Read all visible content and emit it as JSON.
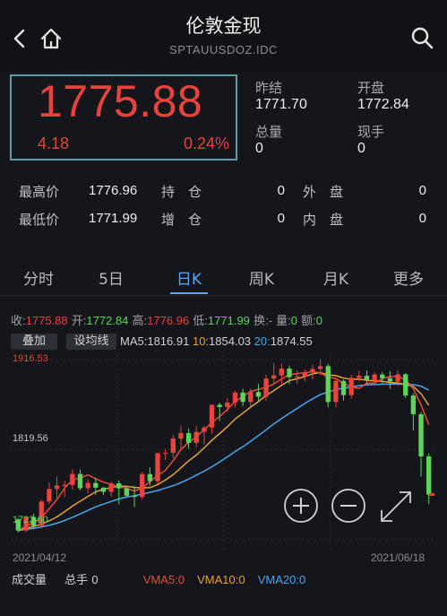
{
  "header": {
    "title": "伦敦金现",
    "subtitle": "SPTAUUSDOZ.IDC"
  },
  "quote": {
    "price": "1775.88",
    "change": "4.18",
    "change_pct": "0.24%",
    "prev_close_label": "昨结",
    "prev_close": "1771.70",
    "open_label": "开盘",
    "open": "1772.84",
    "volume_label": "总量",
    "volume": "0",
    "current_hand_label": "现手",
    "current_hand": "0"
  },
  "stats_rows": [
    {
      "l1": "最高价",
      "v1": "1776.96",
      "l2": "持　仓",
      "v2": "0",
      "l3": "外　盘",
      "v3": "0"
    },
    {
      "l1": "最低价",
      "v1": "1771.99",
      "l2": "增　仓",
      "v2": "0",
      "l3": "内　盘",
      "v3": "0"
    }
  ],
  "tabs": [
    "分时",
    "5日",
    "日K",
    "周K",
    "月K",
    "更多"
  ],
  "active_tab": "日K",
  "ohlc": {
    "close_label": "收:",
    "close": "1775.88",
    "open_label": "开:",
    "open": "1772.84",
    "high_label": "高:",
    "high": "1776.96",
    "low_label": "低:",
    "low": "1771.99",
    "turnover_label": "换:",
    "turnover": "-",
    "qty_label": "量:",
    "qty": "0",
    "amount_label": "额:",
    "amount": "0"
  },
  "overlay": {
    "stack_button": "叠加",
    "indicator_button": "设均线",
    "ma5_label": "MA5:",
    "ma5": "1816.91",
    "ma10_label": "10:",
    "ma10": "1854.03",
    "ma20_label": "20:",
    "ma20": "1874.55"
  },
  "axis": {
    "top": "1916.53",
    "mid": "1819.56",
    "bottom": "1722.60",
    "date_start": "2021/04/12",
    "date_end": "2021/06/18"
  },
  "volume_row": {
    "label": "成交量",
    "hand_label": "总手",
    "hand": "0",
    "vma5_label": "VMA5:",
    "vma5": "0",
    "vma10_label": "VMA10:",
    "vma10": "0",
    "vma20_label": "VMA20:",
    "vma20": "0"
  },
  "colors": {
    "up": "#e8433d",
    "down": "#5fd35a",
    "ma5": "#ea4a3c",
    "ma10": "#e6a23a",
    "ma20": "#4aa6ec",
    "accent": "#5aa8f0"
  },
  "chart_data": {
    "type": "candlestick",
    "y_range": [
      1722.6,
      1916.53
    ],
    "x_range": [
      "2021/04/12",
      "2021/06/18"
    ],
    "ohlc": [
      [
        1743.7,
        1745.1,
        1729.5,
        1731.6
      ],
      [
        1731.6,
        1747.3,
        1730.0,
        1746.2
      ],
      [
        1746.2,
        1749.8,
        1733.0,
        1736.5
      ],
      [
        1736.5,
        1765.2,
        1734.0,
        1763.0
      ],
      [
        1763.0,
        1783.4,
        1760.0,
        1776.6
      ],
      [
        1776.6,
        1790.1,
        1767.0,
        1780.4
      ],
      [
        1780.4,
        1785.5,
        1767.9,
        1781.0
      ],
      [
        1781.0,
        1798.0,
        1776.0,
        1792.8
      ],
      [
        1792.8,
        1797.6,
        1775.0,
        1777.4
      ],
      [
        1777.4,
        1787.1,
        1772.0,
        1783.1
      ],
      [
        1783.1,
        1789.0,
        1770.0,
        1778.0
      ],
      [
        1778.0,
        1779.0,
        1770.0,
        1773.5
      ],
      [
        1773.5,
        1784.5,
        1768.5,
        1782.7
      ],
      [
        1782.7,
        1786.0,
        1760.0,
        1777.2
      ],
      [
        1777.2,
        1780.0,
        1768.0,
        1769.3
      ],
      [
        1769.3,
        1780.0,
        1757.0,
        1767.9
      ],
      [
        1767.9,
        1795.0,
        1765.0,
        1792.7
      ],
      [
        1792.7,
        1800.0,
        1780.0,
        1785.0
      ],
      [
        1785.0,
        1816.0,
        1780.0,
        1815.3
      ],
      [
        1815.3,
        1820.0,
        1808.0,
        1815.8
      ],
      [
        1815.8,
        1835.0,
        1810.0,
        1831.1
      ],
      [
        1831.1,
        1845.0,
        1818.0,
        1837.0
      ],
      [
        1837.0,
        1842.0,
        1820.0,
        1826.4
      ],
      [
        1826.4,
        1845.0,
        1822.0,
        1838.3
      ],
      [
        1838.3,
        1845.0,
        1825.0,
        1843.0
      ],
      [
        1843.0,
        1868.0,
        1836.0,
        1867.6
      ],
      [
        1867.6,
        1870.0,
        1850.0,
        1865.2
      ],
      [
        1865.2,
        1875.0,
        1860.0,
        1870.0
      ],
      [
        1870.0,
        1883.0,
        1865.0,
        1880.9
      ],
      [
        1880.9,
        1885.0,
        1866.0,
        1870.7
      ],
      [
        1870.7,
        1885.0,
        1866.0,
        1881.4
      ],
      [
        1881.4,
        1890.0,
        1872.0,
        1876.4
      ],
      [
        1876.4,
        1900.0,
        1872.0,
        1896.0
      ],
      [
        1896.0,
        1913.0,
        1889.0,
        1899.4
      ],
      [
        1899.4,
        1912.0,
        1890.0,
        1906.8
      ],
      [
        1906.8,
        1910.0,
        1890.0,
        1897.5
      ],
      [
        1897.5,
        1905.0,
        1890.0,
        1898.4
      ],
      [
        1898.4,
        1906.0,
        1893.0,
        1902.7
      ],
      [
        1902.7,
        1911.0,
        1895.0,
        1906.4
      ],
      [
        1906.4,
        1916.5,
        1900.0,
        1909.4
      ],
      [
        1909.4,
        1912.0,
        1865.0,
        1870.6
      ],
      [
        1870.6,
        1895.0,
        1865.0,
        1893.4
      ],
      [
        1893.4,
        1895.0,
        1872.0,
        1878.0
      ],
      [
        1878.0,
        1900.0,
        1874.0,
        1896.8
      ],
      [
        1896.8,
        1904.0,
        1893.0,
        1899.0
      ],
      [
        1899.0,
        1905.0,
        1890.0,
        1894.2
      ],
      [
        1894.2,
        1903.0,
        1892.0,
        1900.3
      ],
      [
        1900.3,
        1903.0,
        1890.0,
        1896.4
      ],
      [
        1896.4,
        1904.0,
        1885.0,
        1892.7
      ],
      [
        1892.7,
        1905.0,
        1888.0,
        1900.5
      ],
      [
        1900.5,
        1902.0,
        1875.0,
        1877.6
      ],
      [
        1877.6,
        1880.0,
        1840.0,
        1857.4
      ],
      [
        1857.4,
        1860.0,
        1790.0,
        1811.8
      ],
      [
        1811.8,
        1815.0,
        1760.0,
        1770.6
      ]
    ],
    "ma5": [
      1731.6,
      1736.5,
      1740.0,
      1745.6,
      1755.2,
      1765.3,
      1777.5,
      1786.4,
      1788.3,
      1791.8,
      1787.6,
      1784.0,
      1781.6,
      1779.2,
      1777.4,
      1774.3,
      1777.5,
      1784.5,
      1791.2,
      1796.8,
      1807.2,
      1819.3,
      1826.9,
      1832.8,
      1840.8,
      1848.4,
      1854.9,
      1862.6,
      1871.3,
      1876.5,
      1882.0,
      1884.3,
      1886.5,
      1890.2,
      1895.6,
      1900.3,
      1901.4,
      1902.4,
      1903.4,
      1902.2,
      1897.4,
      1896.1,
      1890.7,
      1886.9,
      1885.4,
      1891.1,
      1890.9,
      1895.9,
      1898.1,
      1898.3,
      1894.8,
      1884.9,
      1867.6,
      1846.1
    ],
    "ma10": [
      1731.6,
      1734.0,
      1736.0,
      1738.5,
      1742.0,
      1746.5,
      1752.1,
      1758.1,
      1763.3,
      1768.6,
      1773.5,
      1776.3,
      1778.1,
      1779.7,
      1779.4,
      1778.3,
      1777.9,
      1778.0,
      1781.3,
      1786.2,
      1792.0,
      1799.4,
      1807.0,
      1813.3,
      1821.0,
      1829.2,
      1836.5,
      1843.9,
      1852.1,
      1858.6,
      1865.1,
      1871.1,
      1877.7,
      1883.0,
      1888.8,
      1893.8,
      1895.8,
      1898.1,
      1901.2,
      1902.5,
      1899.9,
      1899.2,
      1896.5,
      1895.2,
      1895.5,
      1894.1,
      1893.4,
      1893.1,
      1891.7,
      1891.3,
      1889.6,
      1887.4,
      1879.6,
      1867.1
    ],
    "ma20": [
      1731.6,
      1733.0,
      1734.0,
      1735.5,
      1737.2,
      1739.6,
      1742.6,
      1746.0,
      1749.6,
      1753.4,
      1757.2,
      1760.2,
      1763.0,
      1765.8,
      1767.8,
      1769.3,
      1771.0,
      1772.9,
      1775.0,
      1777.6,
      1780.1,
      1783.4,
      1787.3,
      1791.6,
      1795.8,
      1800.6,
      1805.9,
      1811.3,
      1817.1,
      1822.2,
      1828.2,
      1834.3,
      1840.6,
      1846.8,
      1852.7,
      1858.3,
      1863.7,
      1869.0,
      1874.1,
      1878.6,
      1881.4,
      1884.2,
      1885.6,
      1887.0,
      1888.3,
      1889.1,
      1889.5,
      1889.9,
      1890.0,
      1890.2,
      1889.8,
      1889.4,
      1887.7,
      1883.5
    ]
  }
}
